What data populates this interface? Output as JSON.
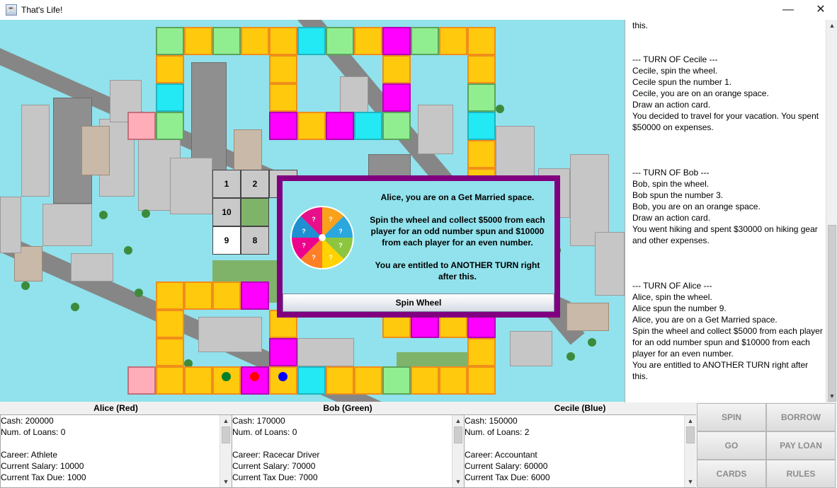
{
  "window": {
    "title": "That's Life!",
    "minimize": "—",
    "maximize": "☐",
    "close": "✕"
  },
  "board": {
    "numbers": [
      "1",
      "2",
      "10",
      "9",
      "8"
    ]
  },
  "dialog": {
    "message": "Alice, you are on a Get Married space.\n\nSpin the wheel and collect $5000 from each player for an odd number spun and $10000 from each player for an even number.\n\nYou are entitled to ANOTHER TURN right after this.",
    "wheel_label": "?",
    "spin_button": "Spin Wheel"
  },
  "log": {
    "text": "this.\n\n\n--- TURN OF Cecile ---\nCecile, spin the wheel.\nCecile spun the number 1.\nCecile, you are on an orange space.\nDraw an action card.\nYou decided to travel for your vacation. You spent $50000 on expenses.\n\n\n\n--- TURN OF Bob ---\nBob, spin the wheel.\nBob spun the number 3.\nBob, you are on an orange space.\nDraw an action card.\nYou went hiking and spent $30000 on hiking gear and other expenses.\n\n\n\n--- TURN OF Alice ---\nAlice, spin the wheel.\nAlice spun the number 9.\nAlice, you are on a Get Married space.\nSpin the wheel and collect $5000 from each player for an odd number spun and $10000 from each player for an even number.\nYou are entitled to ANOTHER TURN right after this."
  },
  "players": [
    {
      "title": "Alice (Red)",
      "text": "Cash: 200000\nNum. of Loans: 0\n\nCareer: Athlete\nCurrent Salary: 10000\nCurrent Tax Due: 1000",
      "color": "#ff0000"
    },
    {
      "title": "Bob (Green)",
      "text": "Cash: 170000\nNum. of Loans: 0\n\nCareer: Racecar Driver\nCurrent Salary: 70000\nCurrent Tax Due: 7000",
      "color": "#00802b"
    },
    {
      "title": "Cecile (Blue)",
      "text": "Cash: 150000\nNum. of Loans: 2\n\nCareer: Accountant\nCurrent Salary: 60000\nCurrent Tax Due: 6000",
      "color": "#0000ff"
    }
  ],
  "buttons": {
    "spin": "SPIN",
    "borrow": "BORROW",
    "go": "GO",
    "payloan": "PAY LOAN",
    "cards": "CARDS",
    "rules": "RULES"
  },
  "colors": {
    "orange": "#ffc90e",
    "green": "#90ee90",
    "cyan": "#22e9f4",
    "magenta": "#ff00ff",
    "pink": "#ffadb9",
    "dialog_border": "#800080",
    "board_bg": "#91e2ec"
  }
}
